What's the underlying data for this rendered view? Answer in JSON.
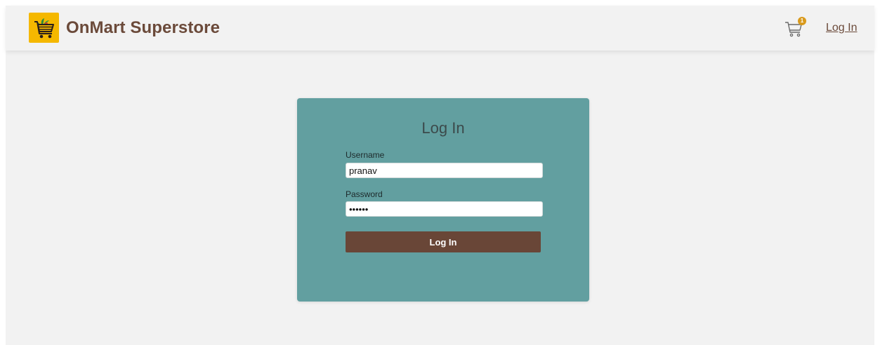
{
  "navbar": {
    "brand_name": "OnMart Superstore",
    "cart_count": "1",
    "login_link": "Log In"
  },
  "login_form": {
    "title": "Log In",
    "username_label": "Username",
    "username_value": "pranav",
    "password_label": "Password",
    "password_value": "pranav",
    "submit_label": "Log In"
  },
  "colors": {
    "brand_brown": "#6b4a3a",
    "logo_yellow": "#f5b800",
    "card_teal": "#629fa0",
    "button_brown": "#694637",
    "badge_orange": "#d99a1c",
    "background": "#f2f2f2"
  },
  "icons": {
    "logo": "shopping-cart-with-vegetables-icon",
    "cart": "cart-icon"
  }
}
